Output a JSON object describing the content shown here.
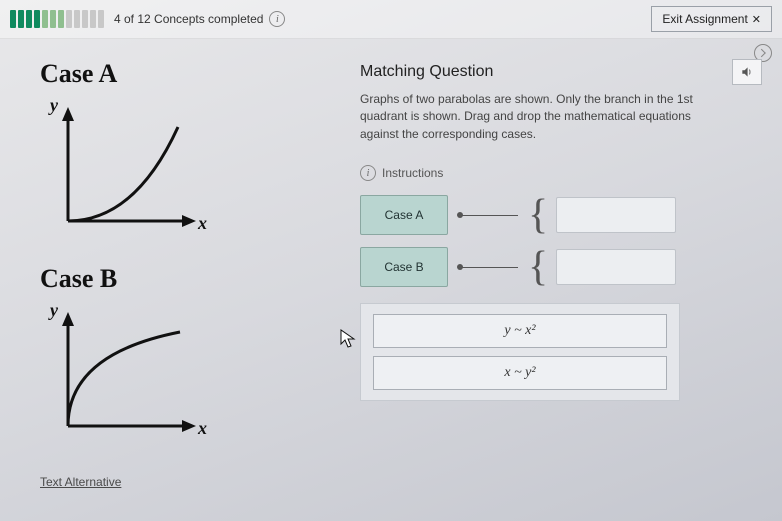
{
  "header": {
    "progress_text": "4 of 12 Concepts completed",
    "exit_label": "Exit Assignment"
  },
  "left": {
    "case_a_title": "Case A",
    "case_b_title": "Case B",
    "axis_y": "y",
    "axis_x": "x",
    "text_alternative": "Text Alternative"
  },
  "right": {
    "question_title": "Matching Question",
    "description": "Graphs of two parabolas are shown. Only the branch in the 1st quadrant is shown. Drag and drop the mathematical equations against the corresponding cases.",
    "instructions_label": "Instructions",
    "targets": [
      {
        "label": "Case A"
      },
      {
        "label": "Case B"
      }
    ],
    "options": [
      {
        "label": "y ~ x²"
      },
      {
        "label": "x ~ y²"
      }
    ]
  }
}
